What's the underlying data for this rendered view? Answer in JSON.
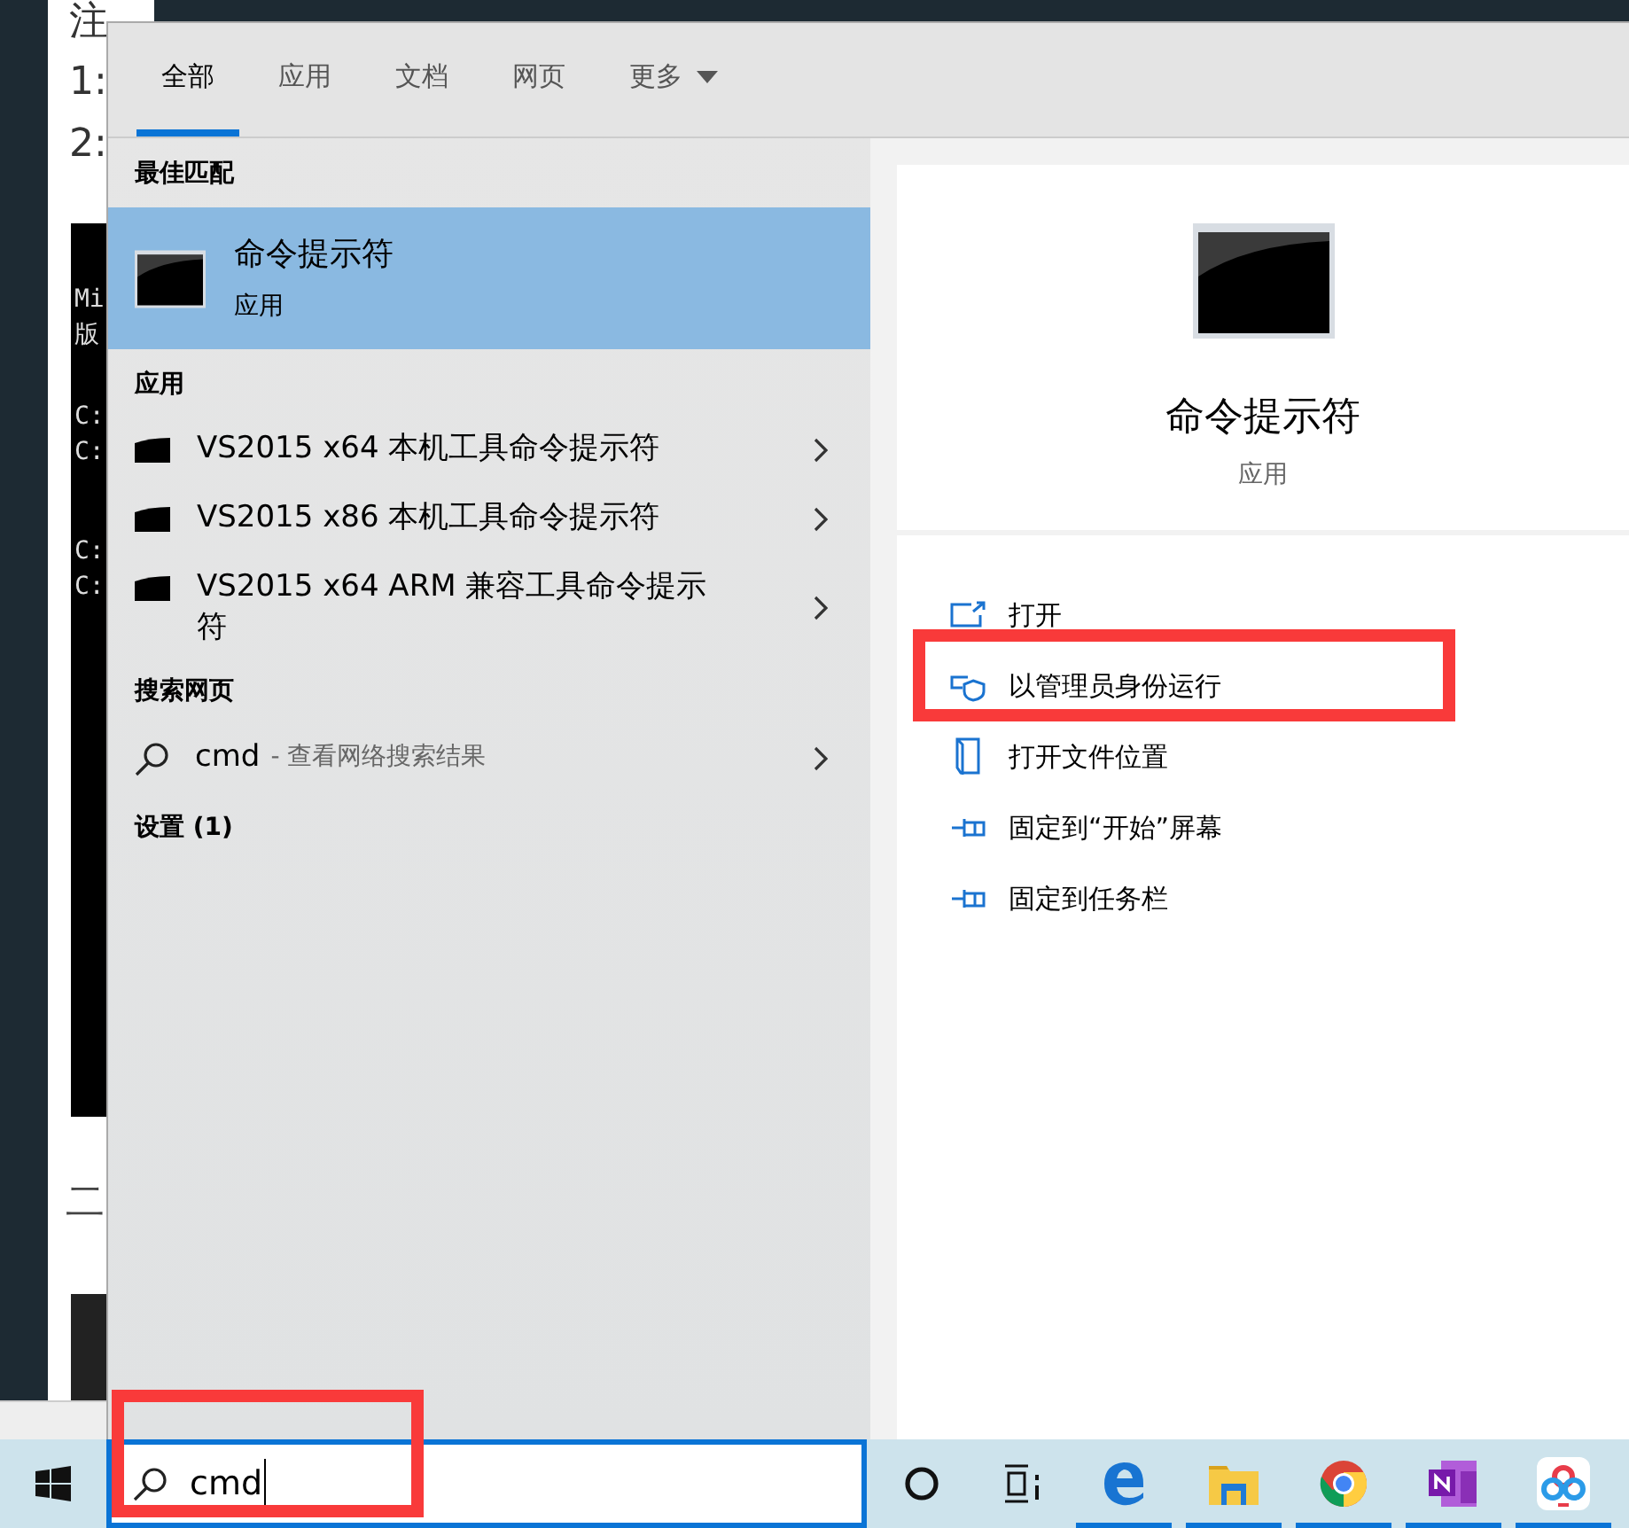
{
  "background_document": {
    "heading": "注",
    "lines": [
      "1:",
      "2:"
    ],
    "screenshot_lines": [
      "Mi",
      "版",
      "C:",
      "C:",
      "C:",
      "C:"
    ],
    "lower_heading": "二"
  },
  "search_flyout": {
    "tabs": [
      {
        "label": "全部",
        "selected": true
      },
      {
        "label": "应用",
        "selected": false
      },
      {
        "label": "文档",
        "selected": false
      },
      {
        "label": "网页",
        "selected": false
      },
      {
        "label": "更多",
        "selected": false,
        "kind": "dropdown"
      }
    ],
    "best_match": {
      "heading": "最佳匹配",
      "title": "命令提示符",
      "subtitle": "应用",
      "selected": true
    },
    "apps": {
      "heading": "应用",
      "items": [
        {
          "label": "VS2015 x64 本机工具命令提示符"
        },
        {
          "label": "VS2015 x86 本机工具命令提示符"
        },
        {
          "label": "VS2015 x64 ARM 兼容工具命令提示符"
        }
      ]
    },
    "web": {
      "heading": "搜索网页",
      "query": "cmd",
      "hint": "- 查看网络搜索结果"
    },
    "settings": {
      "heading": "设置 (1)"
    },
    "detail": {
      "title": "命令提示符",
      "subtitle": "应用",
      "actions": [
        {
          "kind": "open",
          "label": "打开",
          "highlighted": false
        },
        {
          "kind": "admin",
          "label": "以管理员身份运行",
          "highlighted": true
        },
        {
          "kind": "folder",
          "label": "打开文件位置",
          "highlighted": false
        },
        {
          "kind": "pin",
          "label": "固定到“开始”屏幕",
          "highlighted": false
        },
        {
          "kind": "pin",
          "label": "固定到任务栏",
          "highlighted": false
        }
      ]
    }
  },
  "taskbar": {
    "search": {
      "value": "cmd",
      "highlighted": true
    },
    "apps": [
      {
        "kind": "edge",
        "running": true
      },
      {
        "kind": "explorer",
        "running": true
      },
      {
        "kind": "chrome",
        "running": true
      },
      {
        "kind": "onenote",
        "running": true
      },
      {
        "kind": "cloud",
        "running": true
      }
    ]
  }
}
